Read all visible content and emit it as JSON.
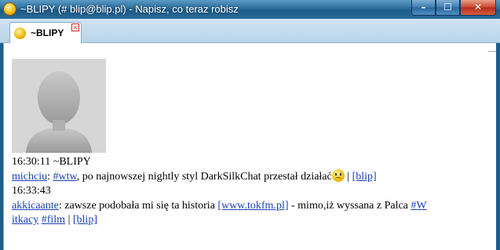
{
  "window": {
    "title": "~BLIPY (# blip@blip.pl) - Napisz, co teraz robisz",
    "buttons": {
      "minimize": "–",
      "maximize": "☐",
      "close": "✕"
    }
  },
  "tab": {
    "label": "~BLIPY",
    "close_glyph": "×"
  },
  "chat": {
    "entries": [
      {
        "time_line": "16:30:11 ~BLIPY"
      },
      {
        "user": "michciu",
        "sep": ": ",
        "tag": "#wtw",
        "text": ", po najnowszej nightly styl DarkSilkChat przestał działać",
        "pipe": " | ",
        "link": "[blip]"
      },
      {
        "time_line": "16:33:43"
      },
      {
        "user": "akkicaante",
        "sep": ": ",
        "text": "zawsze podobała mi się ta historia ",
        "link1": "[www.tokfm.pl]",
        "text2": " - mimo,iż wyssana z Palca ",
        "tag1": "#W",
        "tag1_cont": "itkacy",
        "space": " ",
        "tag2": "#film",
        "pipe": " | ",
        "link": "[blip]"
      }
    ]
  },
  "icons": {
    "app_icon": "smiley-status-icon",
    "emoticon": "worried-smiley-icon",
    "avatar": "default-user-avatar"
  },
  "colors": {
    "link": "#1a3fb0",
    "titlebar": "#2d6e9c"
  }
}
